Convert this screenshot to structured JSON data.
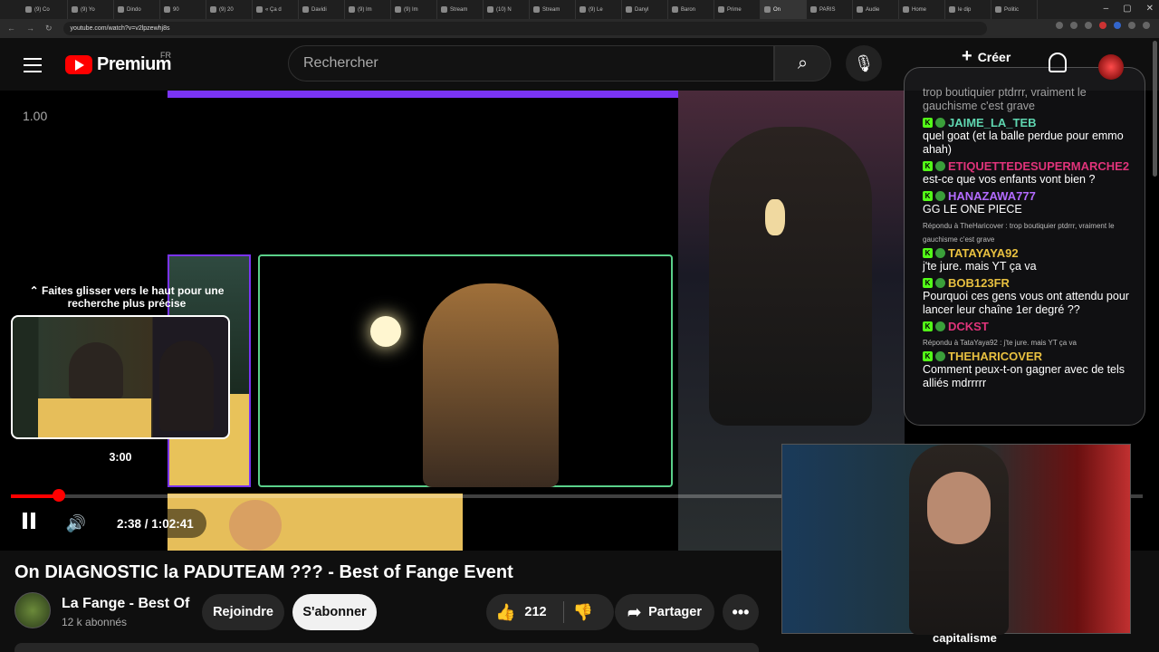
{
  "browser": {
    "tabs": [
      "(9) Co",
      "(9) Yo",
      "Dindo",
      "90 ",
      "(9) 20",
      "« Ça d",
      "Davidi",
      "(9) Im",
      "(9) Im",
      "Stream",
      "(10) N",
      "Stream",
      "(9) Le",
      "Danyl",
      "Baron",
      "Prime",
      "On",
      "PARIS",
      "Audie",
      "Home",
      "le dip",
      "Politic"
    ],
    "active_tab_index": 16,
    "url": "youtube.com/watch?v=v2lpzewhj8s"
  },
  "youtube": {
    "region": "FR",
    "logo_text": "Premium",
    "search_placeholder": "Rechercher",
    "create_label": "Créer"
  },
  "player": {
    "stream_timer": "1.00",
    "seek_hint": "Faites glisser vers le haut pour une recherche plus précise",
    "preview_time": "3:00",
    "current_time": "2:38 / 1:02:41",
    "progress_fraction": 0.042,
    "chat": {
      "top_text": "trop boutiquier ptdrrr, vraiment le gauchisme c'est grave",
      "messages": [
        {
          "reply": "",
          "user": "JAIME_LA_TEB",
          "color": "#5fd6b0",
          "text": "quel goat (et la balle perdue pour emmo ahah)"
        },
        {
          "reply": "",
          "user": "ETIQUETTEDESUPERMARCHE2",
          "color": "#e0337a",
          "text": "est-ce que vos enfants vont bien ?"
        },
        {
          "reply": "",
          "user": "HANAZAWA777",
          "color": "#b36bff",
          "text": "GG LE ONE PIECE"
        },
        {
          "reply": "Répondu à TheHaricover : trop boutiquier ptdrrr, vraiment le gauchisme c'est grave",
          "user": "TATAYAYA92",
          "color": "#e8c040",
          "text": "j'te jure. mais YT ça va"
        },
        {
          "reply": "",
          "user": "BOB123FR",
          "color": "#e8c040",
          "text": "Pourquoi ces gens vous ont attendu pour lancer leur chaîne 1er degré ??"
        },
        {
          "reply": "",
          "user": "DCKST",
          "color": "#e0337a",
          "text": ""
        },
        {
          "reply": "Répondu à TataYaya92 : j'te jure. mais YT ça va",
          "user": "THEHARICOVER",
          "color": "#e8c040",
          "text": "Comment peux-t-on gagner avec de tels alliés mdrrrrr"
        }
      ]
    }
  },
  "pip_caption": "capitalisme",
  "video": {
    "title": "On DIAGNOSTIC la PADUTEAM ??? - Best of Fange Event",
    "channel_name": "La Fange - Best Of",
    "subscribers": "12 k abonnés",
    "join_label": "Rejoindre",
    "subscribe_label": "S'abonner",
    "like_count": "212",
    "share_label": "Partager"
  },
  "colors": {
    "accent": "#ff0000",
    "kick_green": "#53fc18",
    "twitch_purple": "#7a34f5"
  }
}
